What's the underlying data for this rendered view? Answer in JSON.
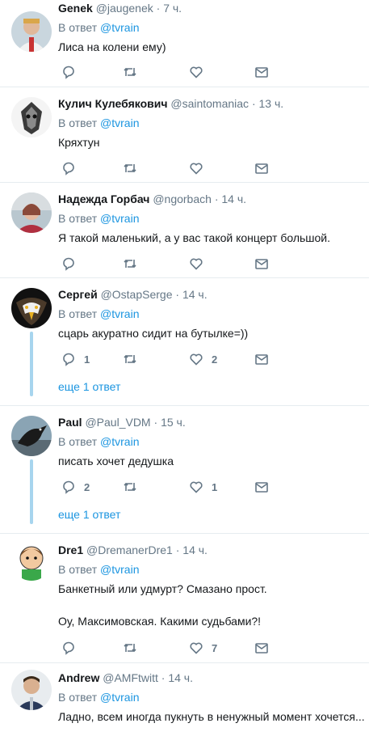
{
  "reply_prefix": "В ответ",
  "tweets": [
    {
      "name": "Genek",
      "handle": "@jaugenek",
      "time": "7 ч.",
      "mention": "@tvrain",
      "text": "Лиса на колени ему)",
      "replies": "",
      "likes": ""
    },
    {
      "name": "Кулич Кулебякович",
      "handle": "@saintomaniac",
      "time": "13 ч.",
      "mention": "@tvrain",
      "text": "Кряхтун",
      "replies": "",
      "likes": ""
    },
    {
      "name": "Надежда Горбач",
      "handle": "@ngorbach",
      "time": "14 ч.",
      "mention": "@tvrain",
      "text": "Я такой маленький, а у вас такой концерт большой.",
      "replies": "",
      "likes": ""
    },
    {
      "name": "Сергей",
      "handle": "@OstapSerge",
      "time": "14 ч.",
      "mention": "@tvrain",
      "text": "сцарь акуратно сидит на бутылке=))",
      "replies": "1",
      "likes": "2",
      "more": "еще 1 ответ"
    },
    {
      "name": "Paul",
      "handle": "@Paul_VDM",
      "time": "15 ч.",
      "mention": "@tvrain",
      "text": "писать хочет дедушка",
      "replies": "2",
      "likes": "1",
      "more": "еще 1 ответ"
    },
    {
      "name": "Dre1",
      "handle": "@DremanerDre1",
      "time": "14 ч.",
      "mention": "@tvrain",
      "text": "Банкетный или удмурт? Смазано прост.",
      "text2": "Оу, Максимовская. Какими судьбами?!",
      "replies": "",
      "likes": "7"
    },
    {
      "name": "Andrew",
      "handle": "@AMFtwitt",
      "time": "14 ч.",
      "mention": "@tvrain",
      "text": "Ладно, всем иногда пукнуть в ненужный момент хочется...",
      "replies": "",
      "likes": ""
    }
  ]
}
